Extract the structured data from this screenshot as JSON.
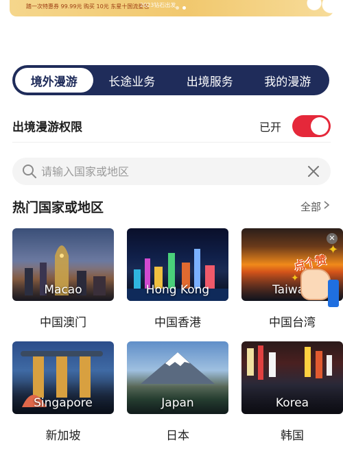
{
  "banner": {
    "promo_text": "踏一次特惠券 99.99元 购买 10元 东星十国流量包",
    "sub_text": "2023钻石出发"
  },
  "tabs": [
    {
      "label": "境外漫游",
      "active": true
    },
    {
      "label": "长途业务",
      "active": false
    },
    {
      "label": "出境服务",
      "active": false
    },
    {
      "label": "我的漫游",
      "active": false
    }
  ],
  "permission": {
    "title": "出境漫游权限",
    "status": "已开",
    "enabled": true
  },
  "search": {
    "placeholder": "请输入国家或地区"
  },
  "hot_section": {
    "title": "热门国家或地区",
    "see_all": "全部"
  },
  "destinations": [
    {
      "image_label": "Macao",
      "name": "中国澳门"
    },
    {
      "image_label": "Hong Kong",
      "name": "中国香港"
    },
    {
      "image_label": "Taiwan",
      "name": "中国台湾"
    },
    {
      "image_label": "Singapore",
      "name": "新加坡"
    },
    {
      "image_label": "Japan",
      "name": "日本"
    },
    {
      "image_label": "Korea",
      "name": "韩国"
    }
  ],
  "like_badge": {
    "text": "点个赞"
  },
  "colors": {
    "tab_bar": "#1f2c5a",
    "toggle_on": "#e5283a",
    "banner": "#f1c86e"
  }
}
